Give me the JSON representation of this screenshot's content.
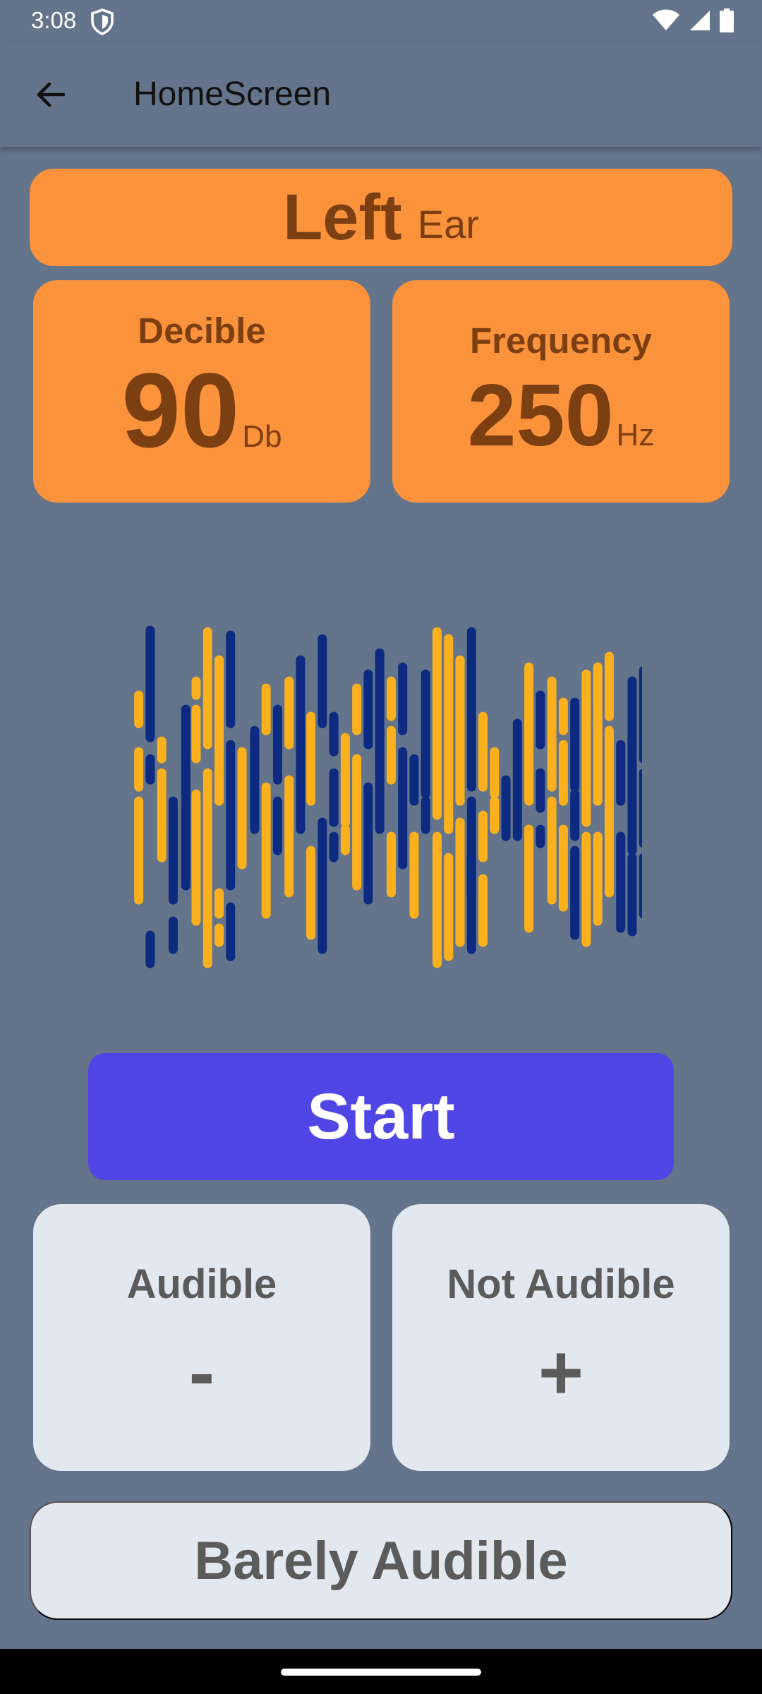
{
  "status_bar": {
    "time": "3:08",
    "icons": [
      "shield-icon",
      "wifi-icon",
      "signal-icon",
      "battery-icon"
    ]
  },
  "app_bar": {
    "title": "HomeScreen",
    "back_icon": "arrow-left-icon"
  },
  "ear": {
    "side": "Left",
    "word": "Ear"
  },
  "decibel": {
    "label": "Decible",
    "value": "90",
    "unit": "Db"
  },
  "frequency": {
    "label": "Frequency",
    "value": "250",
    "unit": "Hz"
  },
  "waveform": {
    "colors": {
      "gold": "#fbb11d",
      "navy": "#0b2a80"
    }
  },
  "start_button": {
    "label": "Start"
  },
  "responses": {
    "audible": {
      "label": "Audible",
      "symbol": "-"
    },
    "not_audible": {
      "label": "Not Audible",
      "symbol": "+"
    },
    "barely_audible": {
      "label": "Barely Audible"
    }
  },
  "colors": {
    "background": "#64748b",
    "card_orange": "#fb923c",
    "card_text_brown": "#7c3f12",
    "start_indigo": "#4f46e5",
    "response_card": "#e2e8f0"
  }
}
